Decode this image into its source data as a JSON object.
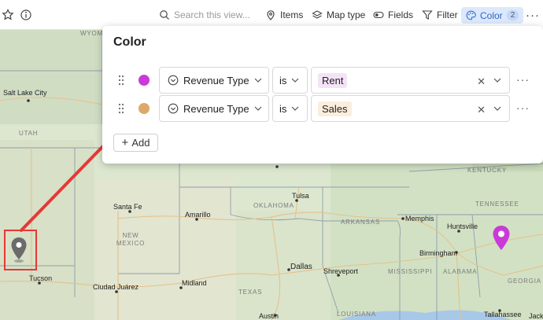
{
  "toolbar": {
    "search_placeholder": "Search this view...",
    "items_label": "Items",
    "map_type_label": "Map type",
    "fields_label": "Fields",
    "filter_label": "Filter",
    "color_label": "Color",
    "color_count": "2"
  },
  "popup": {
    "title": "Color",
    "rules": [
      {
        "field": "Revenue Type",
        "operator": "is",
        "value": "Rent",
        "swatch": "#c93bd8",
        "tag_bg": "#f4e3f7"
      },
      {
        "field": "Revenue Type",
        "operator": "is",
        "value": "Sales",
        "swatch": "#dca96a",
        "tag_bg": "#fbeedd"
      }
    ],
    "add_label": "Add"
  },
  "map": {
    "cities": [
      "Salt Lake City",
      "Santa Fe",
      "Amarillo",
      "Tulsa",
      "Memphis",
      "Huntsville",
      "Birmingham",
      "Tucson",
      "Ciudad Juárez",
      "Midland",
      "Dallas",
      "Shreveport",
      "Austin",
      "Tallahassee",
      "Jack"
    ],
    "states": [
      "WYOMING",
      "UTAH",
      "NEW MEXICO",
      "OKLAHOMA",
      "ARKANSAS",
      "TEXAS",
      "LOUISIANA",
      "MISSISSIPPI",
      "ALABAMA",
      "GEORGIA",
      "TENNESSEE",
      "KENTUCKY"
    ],
    "pins": [
      {
        "type": "gray",
        "color": "#6b6b6b"
      },
      {
        "type": "rent",
        "color": "#c93bd8"
      }
    ]
  },
  "annotation": {
    "arrow_color": "#e53935"
  }
}
